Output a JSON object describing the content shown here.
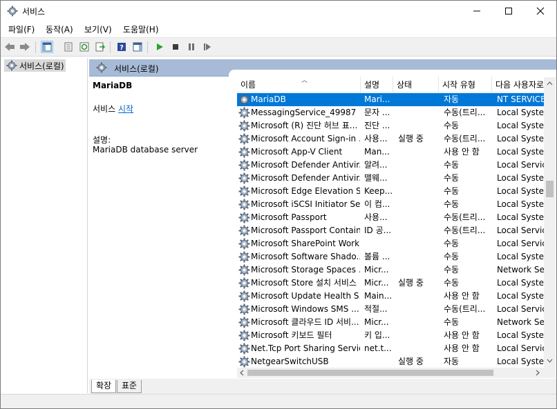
{
  "window": {
    "title": "서비스",
    "controls": {
      "minimize": "—",
      "maximize": "☐",
      "close": "✕"
    }
  },
  "menu": [
    "파일(F)",
    "동작(A)",
    "보기(V)",
    "도움말(H)"
  ],
  "tree": {
    "root": "서비스(로컬)"
  },
  "content_header": "서비스(로컬)",
  "detail": {
    "service_name": "MariaDB",
    "action_prefix": "서비스",
    "action_link": "시작",
    "description_label": "설명:",
    "description": "MariaDB database server"
  },
  "columns": {
    "name": "이름",
    "description": "설명",
    "status": "상태",
    "startup": "시작 유형",
    "logon": "다음 사용자로"
  },
  "services": [
    {
      "name": "MariaDB",
      "description": "Mari...",
      "status": "",
      "startup": "자동",
      "logon": "NT SERVICE\\MariaDB",
      "selected": true
    },
    {
      "name": "MessagingService_49987",
      "description": "문자 ...",
      "status": "",
      "startup": "수동(트리...",
      "logon": "Local System"
    },
    {
      "name": "Microsoft (R) 진단 허브 표...",
      "description": "진단 ...",
      "status": "",
      "startup": "수동",
      "logon": "Local System"
    },
    {
      "name": "Microsoft Account Sign-in ...",
      "description": "사용...",
      "status": "실행 중",
      "startup": "수동(트리...",
      "logon": "Local System"
    },
    {
      "name": "Microsoft App-V Client",
      "description": "Man...",
      "status": "",
      "startup": "사용 안 함",
      "logon": "Local System"
    },
    {
      "name": "Microsoft Defender Antivir...",
      "description": "알려...",
      "status": "",
      "startup": "수동",
      "logon": "Local Service"
    },
    {
      "name": "Microsoft Defender Antivir...",
      "description": "맬웨...",
      "status": "",
      "startup": "수동",
      "logon": "Local System"
    },
    {
      "name": "Microsoft Edge Elevation S...",
      "description": "Keep...",
      "status": "",
      "startup": "수동",
      "logon": "Local System"
    },
    {
      "name": "Microsoft iSCSI Initiator Se...",
      "description": "이 컴...",
      "status": "",
      "startup": "수동",
      "logon": "Local System"
    },
    {
      "name": "Microsoft Passport",
      "description": "사용...",
      "status": "",
      "startup": "수동(트리...",
      "logon": "Local System"
    },
    {
      "name": "Microsoft Passport Container",
      "description": "ID 공...",
      "status": "",
      "startup": "수동(트리...",
      "logon": "Local Service"
    },
    {
      "name": "Microsoft SharePoint Work...",
      "description": "",
      "status": "",
      "startup": "수동",
      "logon": "Local Service"
    },
    {
      "name": "Microsoft Software Shado...",
      "description": "볼륨 ...",
      "status": "",
      "startup": "수동",
      "logon": "Local System"
    },
    {
      "name": "Microsoft Storage Spaces ...",
      "description": "Micr...",
      "status": "",
      "startup": "수동",
      "logon": "Network Service"
    },
    {
      "name": "Microsoft Store 설치 서비스",
      "description": "Micr...",
      "status": "실행 중",
      "startup": "수동",
      "logon": "Local System"
    },
    {
      "name": "Microsoft Update Health S...",
      "description": "Main...",
      "status": "",
      "startup": "사용 안 함",
      "logon": "Local System"
    },
    {
      "name": "Microsoft Windows SMS ...",
      "description": "적절...",
      "status": "",
      "startup": "수동(트리...",
      "logon": "Local Service"
    },
    {
      "name": "Microsoft 클라우드 ID 서비...",
      "description": "Micr...",
      "status": "",
      "startup": "수동",
      "logon": "Network Service"
    },
    {
      "name": "Microsoft 키보드 필터",
      "description": "키 입...",
      "status": "",
      "startup": "사용 안 함",
      "logon": "Local System"
    },
    {
      "name": "Net.Tcp Port Sharing Service",
      "description": "net.t...",
      "status": "",
      "startup": "사용 안 함",
      "logon": "Local Service"
    },
    {
      "name": "NetgearSwitchUSB",
      "description": "",
      "status": "실행 중",
      "startup": "자동",
      "logon": "Local System"
    }
  ],
  "tabs": [
    "확장",
    "표준"
  ]
}
